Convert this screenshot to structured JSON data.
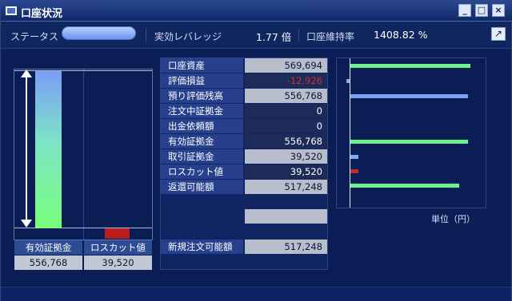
{
  "window": {
    "title": "口座状況",
    "buttons": {
      "minimize": "_",
      "maximize": "□",
      "close": "×"
    }
  },
  "status": {
    "status_label": "ステータス",
    "leverage_label": "実効レバレッジ",
    "leverage_value": "1.77 倍",
    "maintenance_label": "口座維持率",
    "maintenance_value": "1408.82 %",
    "popout_icon": "↗"
  },
  "left_chart": {
    "bars": [
      {
        "label": "有効証拠金",
        "value": "556,768",
        "level": 1.0,
        "color": "#79ff7c"
      },
      {
        "label": "ロスカット値",
        "value": "39,520",
        "level": 0.071,
        "color": "#b81c1c"
      }
    ]
  },
  "table": {
    "rows": [
      {
        "label": "口座資産",
        "value": "569,694"
      },
      {
        "label": "評価損益",
        "value": "-12,926"
      },
      {
        "label": "預り評価残高",
        "value": "556,768"
      },
      {
        "label": "注文中証拠金",
        "value": "0"
      },
      {
        "label": "出金依頼額",
        "value": "0"
      },
      {
        "label": "有効証拠金",
        "value": "556,768"
      },
      {
        "label": "取引証拠金",
        "value": "39,520"
      },
      {
        "label": "ロスカット値",
        "value": "39,520"
      },
      {
        "label": "返還可能額",
        "value": "517,248"
      }
    ],
    "new_order": {
      "label": "新規注文可能額",
      "value": "517,248"
    }
  },
  "right_chart": {
    "unit_label": "単位（円）",
    "bars": [
      {
        "value": 569694,
        "color": "#6ff08a"
      },
      {
        "value": 12926,
        "color": "#86a9f0"
      },
      {
        "value": 556768,
        "color": "#7d9ff3"
      },
      {
        "value": 0,
        "color": "#7d9ff3"
      },
      {
        "value": 0,
        "color": "#7d9ff3"
      },
      {
        "value": 556768,
        "color": "#6ff08a"
      },
      {
        "value": 39520,
        "color": "#86a9f0"
      },
      {
        "value": 39520,
        "color": "#c02b2b"
      },
      {
        "value": 517248,
        "color": "#6ff08a"
      }
    ]
  }
}
